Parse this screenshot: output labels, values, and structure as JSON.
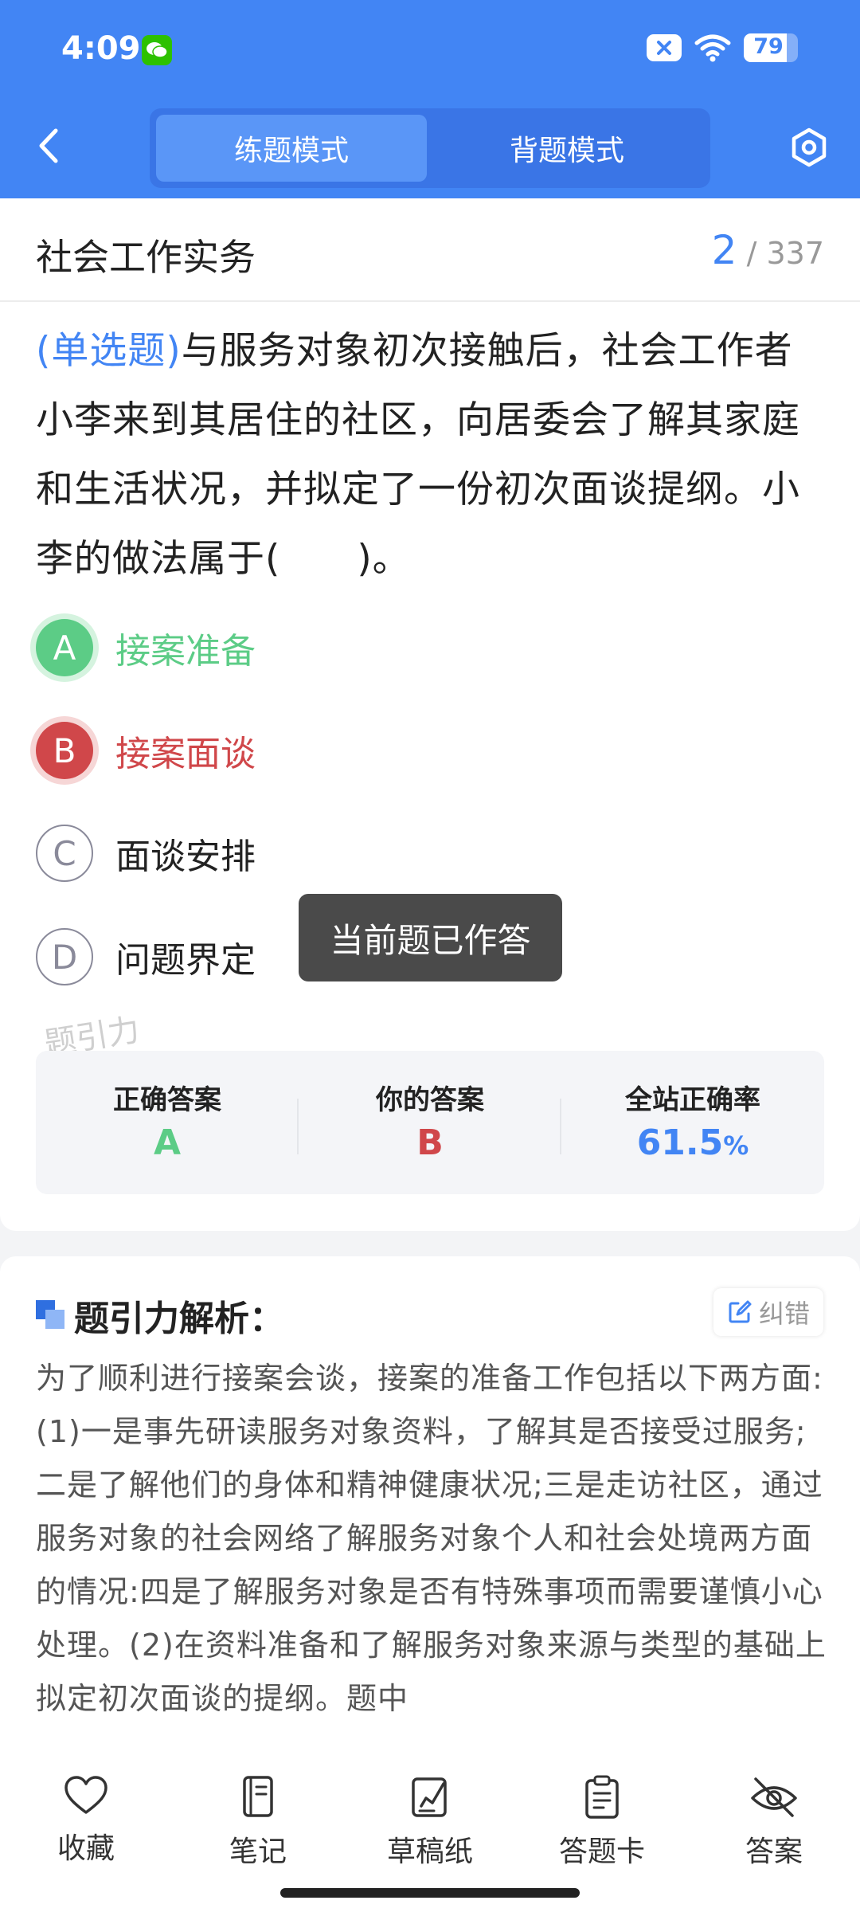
{
  "status": {
    "time": "4:09",
    "battery": "79",
    "battery_level": 0.79
  },
  "header": {
    "tabs": [
      {
        "label": "练题模式",
        "active": true
      },
      {
        "label": "背题模式",
        "active": false
      }
    ]
  },
  "subject": {
    "title": "社会工作实务",
    "current": "2",
    "total": "/ 337"
  },
  "question": {
    "type": "(单选题)",
    "text": "与服务对象初次接触后，社会工作者小李来到其居住的社区，向居委会了解其家庭和生活状况，并拟定了一份初次面谈提纲。小李的做法属于(　　)。"
  },
  "options": [
    {
      "letter": "A",
      "label": "接案准备",
      "state": "correct"
    },
    {
      "letter": "B",
      "label": "接案面谈",
      "state": "wrong"
    },
    {
      "letter": "C",
      "label": "面谈安排",
      "state": "normal"
    },
    {
      "letter": "D",
      "label": "问题界定",
      "state": "normal"
    }
  ],
  "watermark": "题引力",
  "toast": "当前题已作答",
  "answer_summary": {
    "correct_label": "正确答案",
    "correct_value": "A",
    "yours_label": "你的答案",
    "yours_value": "B",
    "rate_label": "全站正确率",
    "rate_value": "61.5",
    "rate_unit": "%"
  },
  "explanation": {
    "title": "题引力解析：",
    "correct_button": "纠错",
    "text": "为了顺利进行接案会谈，接案的准备工作包括以下两方面:(1)一是事先研读服务对象资料，了解其是否接受过服务;二是了解他们的身体和精神健康状况;三是走访社区，通过服务对象的社会网络了解服务对象个人和社会处境两方面的情况:四是了解服务对象是否有特殊事项而需要谨慎小心处理。(2)在资料准备和了解服务对象来源与类型的基础上拟定初次面谈的提纲。题中"
  },
  "bottom_nav": [
    {
      "label": "收藏",
      "icon": "heart-icon"
    },
    {
      "label": "笔记",
      "icon": "notebook-icon"
    },
    {
      "label": "草稿纸",
      "icon": "draft-icon"
    },
    {
      "label": "答题卡",
      "icon": "clipboard-icon"
    },
    {
      "label": "答案",
      "icon": "eye-off-icon"
    }
  ],
  "colors": {
    "primary": "#4285f4",
    "correct": "#5ccc86",
    "wrong": "#d0474a"
  }
}
